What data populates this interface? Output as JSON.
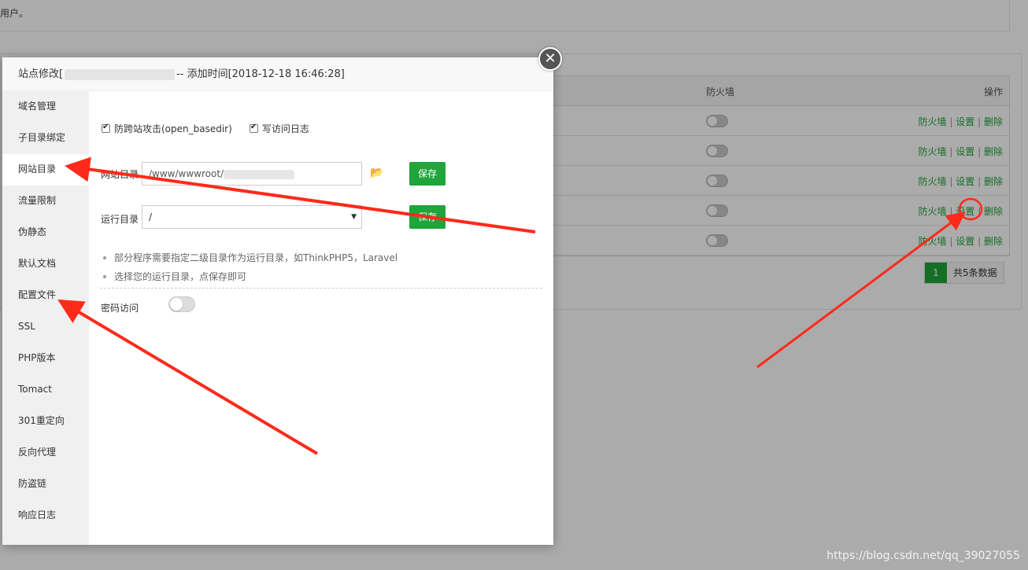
{
  "background": {
    "notice_text": "用户。",
    "table_header": {
      "firewall": "防火墙",
      "actions": "操作"
    },
    "rows": [
      {
        "actions": [
          "防火墙",
          "设置",
          "删除"
        ]
      },
      {
        "actions": [
          "防火墙",
          "设置",
          "删除"
        ]
      },
      {
        "actions": [
          "防火墙",
          "设置",
          "删除"
        ]
      },
      {
        "actions": [
          "防火墙",
          "设置",
          "删除"
        ]
      },
      {
        "actions": [
          "防火墙",
          "设置",
          "删除"
        ]
      }
    ],
    "action_separator": "|",
    "pager": {
      "current": "1",
      "total": "共5条数据"
    }
  },
  "modal": {
    "title_prefix": "站点修改[",
    "title_suffix": "-- 添加时间[2018-12-18 16:46:28]",
    "close_symbol": "✕",
    "sidebar": [
      "域名管理",
      "子目录绑定",
      "网站目录",
      "流量限制",
      "伪静态",
      "默认文档",
      "配置文件",
      "SSL",
      "PHP版本",
      "Tomact",
      "301重定向",
      "反向代理",
      "防盗链",
      "响应日志"
    ],
    "active_index": 2,
    "checkboxes": {
      "anti_cross": "防跨站攻击(open_basedir)",
      "write_log": "写访问日志"
    },
    "site_dir": {
      "label": "网站目录",
      "value": "/www/wwwroot/",
      "save": "保存"
    },
    "run_dir": {
      "label": "运行目录",
      "value": "/",
      "save": "保存"
    },
    "tips": [
      "部分程序需要指定二级目录作为运行目录，如ThinkPHP5，Laravel",
      "选择您的运行目录，点保存即可"
    ],
    "password_access": "密码访问"
  },
  "watermark": "https://blog.csdn.net/qq_39027055",
  "colors": {
    "accent": "#20a53a",
    "annotation": "#ff2a1a"
  }
}
